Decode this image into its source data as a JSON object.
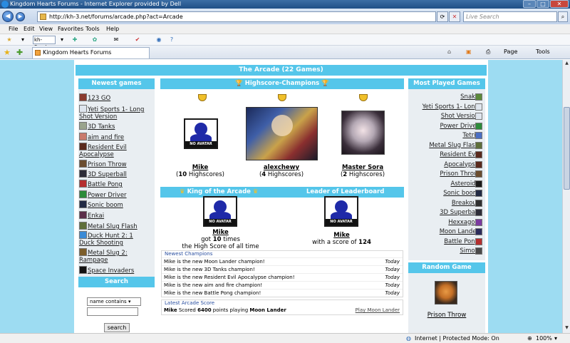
{
  "browser": {
    "title": "Kingdom Hearts Forums - Internet Explorer provided by Dell",
    "url": "http://kh-3.net/forums/arcade.php?act=Arcade",
    "search_placeholder": "Live Search",
    "menu": [
      "File",
      "Edit",
      "View",
      "Favorites",
      "Tools",
      "Help"
    ],
    "links_box": "kh-3.net",
    "tab_label": "Kingdom Hearts Forums",
    "page_menu": "Page",
    "tools_menu": "Tools",
    "status_zone": "Internet | Protected Mode: On",
    "zoom": "100%"
  },
  "arcade": {
    "title": "The Arcade (22 Games)",
    "newest_games_title": "Newest games",
    "newest_games": [
      {
        "name": "123 GO",
        "color": "#8b3b2e"
      },
      {
        "name": "Yeti Sports 1- Long Shot Version",
        "color": "#dfe6ef"
      },
      {
        "name": "3D Tanks",
        "color": "#9aa48d"
      },
      {
        "name": "aim and fire",
        "color": "#c97a6c"
      },
      {
        "name": "Resident Evil Apocalypse",
        "color": "#5a2a1d"
      },
      {
        "name": "Prison Throw",
        "color": "#6b4d2f"
      },
      {
        "name": "3D Superball",
        "color": "#2d2d38"
      },
      {
        "name": "Battle Pong",
        "color": "#b52f2f"
      },
      {
        "name": "Power Driver",
        "color": "#2c8c3a"
      },
      {
        "name": "Sonic boom",
        "color": "#222a44"
      },
      {
        "name": "Enkai",
        "color": "#5c2f4a"
      },
      {
        "name": "Metal Slug Flash",
        "color": "#5f6f3a"
      },
      {
        "name": "Duck Hunt 2: 1 Duck Shooting",
        "color": "#3b8bd6"
      },
      {
        "name": "Metal Slug 2: Rampage",
        "color": "#7c5e2b"
      },
      {
        "name": "Space Invaders",
        "color": "#121212"
      }
    ],
    "search_title": "Search",
    "search_mode": "name contains",
    "search_button": "search",
    "champions_title": "Highscore-Champions",
    "champions": [
      {
        "name": "Mike",
        "count": "10",
        "suffix": " Highscores)"
      },
      {
        "name": "alexchewy",
        "count": "4",
        "suffix": " Highscores)"
      },
      {
        "name": "Master Sora",
        "count": "2",
        "suffix": " Highscores)"
      }
    ],
    "no_avatar": "NO AVATAR",
    "king_title": "King of the Arcade",
    "king_name": "Mike",
    "king_got": "got ",
    "king_times": "10",
    "king_times_suffix": " times",
    "king_line2": "the High Score of all time",
    "leader_title": "Leader of Leaderboard",
    "leader_name": "Mike",
    "leader_prefix": "with a score of ",
    "leader_score": "124",
    "newest_champions_title": "Newest Champions",
    "newest_champions": [
      {
        "text": "Mike is the new Moon Lander champion!",
        "when": "Today"
      },
      {
        "text": "Mike is the new 3D Tanks champion!",
        "when": "Today"
      },
      {
        "text": "Mike is the new Resident Evil Apocalypse champion!",
        "when": "Today"
      },
      {
        "text": "Mike is the new aim and fire champion!",
        "when": "Today"
      },
      {
        "text": "Mike is the new Battle Pong champion!",
        "when": "Today"
      }
    ],
    "latest_score_title": "Latest Arcade Score",
    "latest_score_user": "Mike",
    "latest_score_mid": " Scored ",
    "latest_score_points": "6400",
    "latest_score_mid2": " points playing ",
    "latest_score_game": "Moon Lander",
    "latest_score_link": "Play Moon Lander",
    "most_played_title": "Most Played Games",
    "most_played": [
      {
        "name": "Snake",
        "color": "#5c8a3a"
      },
      {
        "name": "Yeti Sports 1- Long",
        "color": "#dfe6ef"
      },
      {
        "name": "Shot Version",
        "color": "#dfe6ef"
      },
      {
        "name": "Power Driver",
        "color": "#2c8c3a"
      },
      {
        "name": "Tetris",
        "color": "#4a6fc4"
      },
      {
        "name": "Metal Slug Flash",
        "color": "#5f6f3a"
      },
      {
        "name": "Resident Evil",
        "color": "#5a2a1d"
      },
      {
        "name": "Apocalypse",
        "color": "#5a2a1d"
      },
      {
        "name": "Prison Throw",
        "color": "#6b4d2f"
      },
      {
        "name": "Asteroids",
        "color": "#1a1a1a"
      },
      {
        "name": "Sonic boom",
        "color": "#222a44"
      },
      {
        "name": "Breakout",
        "color": "#303030"
      },
      {
        "name": "3D Superball",
        "color": "#2d2d38"
      },
      {
        "name": "Hexxagon",
        "color": "#7b3aa0"
      },
      {
        "name": "Moon Lander",
        "color": "#2c2c5a"
      },
      {
        "name": "Battle Pong",
        "color": "#b52f2f"
      },
      {
        "name": "Simon",
        "color": "#4a4a4a"
      }
    ],
    "random_game_title": "Random Game",
    "random_game_name": "Prison Throw"
  },
  "colors": {
    "page_bg": "#9ddcf2",
    "header_blue": "#55c6ea",
    "panel_gray": "#e9eef2"
  }
}
